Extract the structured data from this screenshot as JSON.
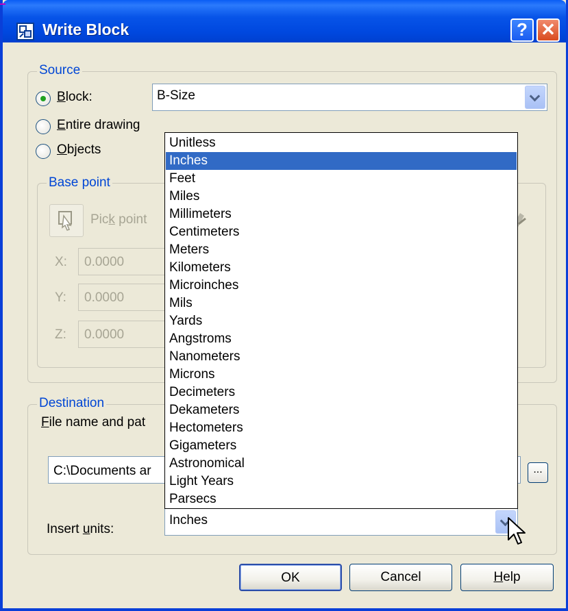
{
  "window": {
    "title": "Write Block",
    "help_label": "?",
    "close_label": "✕",
    "app_icon": "write-block-icon"
  },
  "source": {
    "group_label": "Source",
    "options": [
      {
        "label_accel": "B",
        "label_rest": "lock:",
        "checked": true
      },
      {
        "label_accel": "E",
        "label_rest": "ntire drawing",
        "checked": false
      },
      {
        "label_accel": "O",
        "label_rest": "bjects",
        "checked": false
      }
    ],
    "block_combo_value": "B-Size"
  },
  "base_point": {
    "group_label": "Base point",
    "pick_label_pre": "Pic",
    "pick_label_accel": "k",
    "pick_label_post": " point",
    "x_label": "X:",
    "y_label": "Y:",
    "z_label": "Z:",
    "x_value": "0.0000",
    "y_value": "0.0000",
    "z_value": "0.0000"
  },
  "destination": {
    "group_label": "Destination",
    "file_label_accel": "F",
    "file_label_rest": "ile name and pat",
    "file_value": "C:\\Documents ar",
    "browse_label": "...",
    "insert_units_pre": "Insert ",
    "insert_units_accel": "u",
    "insert_units_post": "nits:",
    "insert_units_value": "Inches"
  },
  "units_list": {
    "items": [
      "Unitless",
      "Inches",
      "Feet",
      "Miles",
      "Millimeters",
      "Centimeters",
      "Meters",
      "Kilometers",
      "Microinches",
      "Mils",
      "Yards",
      "Angstroms",
      "Nanometers",
      "Microns",
      "Decimeters",
      "Dekameters",
      "Hectometers",
      "Gigameters",
      "Astronomical",
      "Light Years",
      "Parsecs"
    ],
    "selected_index": 1
  },
  "buttons": {
    "ok": "OK",
    "cancel": "Cancel",
    "help_accel": "H",
    "help_rest": "elp"
  },
  "colors": {
    "titlebar": "#0054e3",
    "group_title": "#0046d5",
    "selection": "#316ac5",
    "dialog_bg": "#ece9d8"
  }
}
